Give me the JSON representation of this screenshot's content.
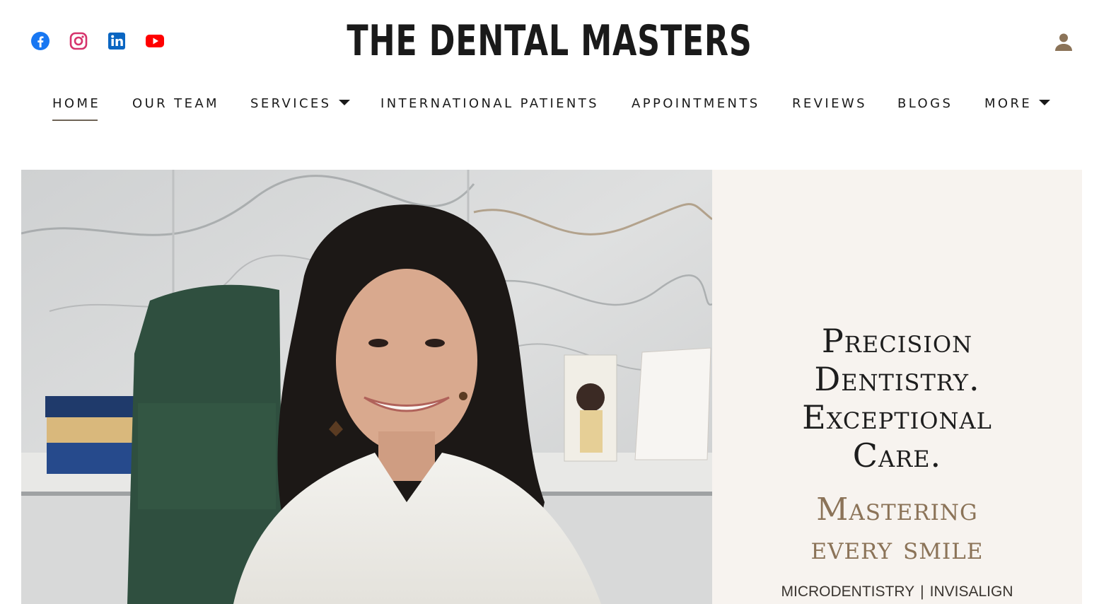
{
  "header": {
    "brand": "THE DENTAL MASTERS",
    "social": [
      {
        "name": "facebook-icon",
        "color": "#1877f2"
      },
      {
        "name": "instagram-icon",
        "color": "#d6336c"
      },
      {
        "name": "linkedin-icon",
        "color": "#0a66c2"
      },
      {
        "name": "youtube-icon",
        "color": "#ff0000"
      }
    ],
    "account_icon": "person-icon",
    "account_color": "#8b7358"
  },
  "nav": {
    "items": [
      {
        "label": "HOME",
        "active": true
      },
      {
        "label": "OUR TEAM"
      },
      {
        "label": "SERVICES",
        "dropdown": true
      },
      {
        "label": "INTERNATIONAL PATIENTS"
      },
      {
        "label": "APPOINTMENTS"
      },
      {
        "label": "REVIEWS"
      },
      {
        "label": "BLOGS"
      },
      {
        "label": "MORE",
        "dropdown": true
      }
    ]
  },
  "hero": {
    "headline_lines": [
      "Precision",
      "Dentistry.",
      "Exceptional",
      "Care."
    ],
    "tagline_lines": [
      "Mastering",
      "every smile"
    ],
    "services": [
      "MICRODENTISTRY",
      "INVISALIGN"
    ],
    "separator": "|",
    "panel_color": "#f7f3ef",
    "accent_color": "#8b7358"
  }
}
